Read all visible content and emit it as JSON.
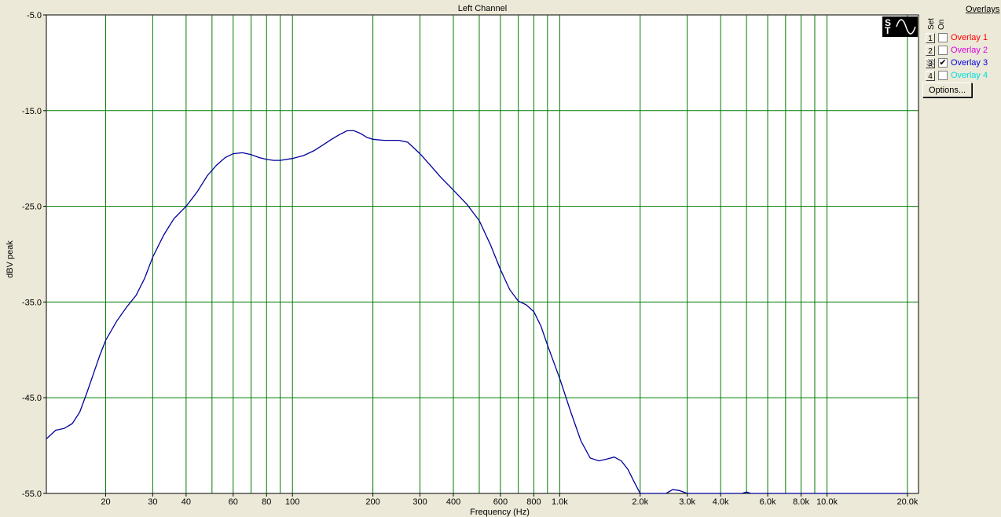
{
  "chart_data": {
    "type": "line",
    "title": "Left Channel",
    "xlabel": "Frequency (Hz)",
    "ylabel": "dBV peak",
    "x_scale": "log",
    "xlim": [
      12,
      22000
    ],
    "ylim": [
      -55,
      -5
    ],
    "y_ticks": [
      -5,
      -15,
      -25,
      -35,
      -45,
      -55
    ],
    "y_tick_labels": [
      "-5.0",
      "-15.0",
      "-25.0",
      "-35.0",
      "-45.0",
      "-55.0"
    ],
    "x_ticks": [
      20,
      30,
      40,
      60,
      80,
      100,
      200,
      300,
      400,
      600,
      800,
      1000,
      2000,
      3000,
      4000,
      6000,
      8000,
      10000,
      20000
    ],
    "x_tick_labels": [
      "20",
      "30",
      "40",
      "60",
      "80",
      "100",
      "200",
      "300",
      "400",
      "600",
      "800",
      "1.0k",
      "2.0k",
      "3.0k",
      "4.0k",
      "6.0k",
      "8.0k",
      "10.0k",
      "20.0k"
    ],
    "x_gridlines": [
      20,
      30,
      40,
      50,
      60,
      70,
      80,
      90,
      100,
      200,
      300,
      400,
      500,
      600,
      700,
      800,
      900,
      1000,
      2000,
      3000,
      4000,
      5000,
      6000,
      7000,
      8000,
      9000,
      10000,
      20000
    ],
    "grid": true,
    "background": "#ffffff",
    "grid_color": "#007a00",
    "series": [
      {
        "color": "#000099",
        "points": [
          [
            12,
            -49.3
          ],
          [
            13,
            -48.4
          ],
          [
            14,
            -48.2
          ],
          [
            15,
            -47.7
          ],
          [
            16,
            -46.5
          ],
          [
            17,
            -44.5
          ],
          [
            18,
            -42.5
          ],
          [
            19,
            -40.6
          ],
          [
            20,
            -39.0
          ],
          [
            22,
            -37.0
          ],
          [
            24,
            -35.5
          ],
          [
            26,
            -34.3
          ],
          [
            28,
            -32.5
          ],
          [
            30,
            -30.3
          ],
          [
            33,
            -28.0
          ],
          [
            36,
            -26.3
          ],
          [
            40,
            -25.0
          ],
          [
            44,
            -23.5
          ],
          [
            48,
            -21.8
          ],
          [
            52,
            -20.7
          ],
          [
            56,
            -19.9
          ],
          [
            60,
            -19.5
          ],
          [
            65,
            -19.4
          ],
          [
            70,
            -19.6
          ],
          [
            75,
            -19.9
          ],
          [
            80,
            -20.1
          ],
          [
            85,
            -20.2
          ],
          [
            90,
            -20.2
          ],
          [
            100,
            -20.0
          ],
          [
            110,
            -19.7
          ],
          [
            120,
            -19.2
          ],
          [
            130,
            -18.6
          ],
          [
            140,
            -18.0
          ],
          [
            150,
            -17.5
          ],
          [
            160,
            -17.1
          ],
          [
            170,
            -17.1
          ],
          [
            180,
            -17.4
          ],
          [
            190,
            -17.8
          ],
          [
            200,
            -18.0
          ],
          [
            220,
            -18.1
          ],
          [
            250,
            -18.1
          ],
          [
            270,
            -18.3
          ],
          [
            300,
            -19.5
          ],
          [
            330,
            -20.8
          ],
          [
            360,
            -22.0
          ],
          [
            400,
            -23.3
          ],
          [
            450,
            -24.8
          ],
          [
            500,
            -26.5
          ],
          [
            550,
            -29.0
          ],
          [
            600,
            -31.6
          ],
          [
            650,
            -33.7
          ],
          [
            700,
            -34.9
          ],
          [
            750,
            -35.3
          ],
          [
            800,
            -36.0
          ],
          [
            850,
            -37.5
          ],
          [
            900,
            -39.5
          ],
          [
            1000,
            -43.0
          ],
          [
            1100,
            -46.5
          ],
          [
            1200,
            -49.5
          ],
          [
            1300,
            -51.3
          ],
          [
            1400,
            -51.6
          ],
          [
            1500,
            -51.4
          ],
          [
            1600,
            -51.2
          ],
          [
            1700,
            -51.6
          ],
          [
            1800,
            -52.5
          ],
          [
            1900,
            -53.8
          ],
          [
            2000,
            -55.0
          ],
          [
            2500,
            -55.0
          ],
          [
            2650,
            -54.6
          ],
          [
            2800,
            -54.7
          ],
          [
            3000,
            -55.0
          ],
          [
            4800,
            -55.0
          ],
          [
            5000,
            -54.85
          ],
          [
            5200,
            -55.0
          ],
          [
            20000,
            -55.0
          ]
        ]
      }
    ]
  },
  "panel": {
    "overlays_title": "Overlays",
    "set_label": "Set",
    "on_label": "On",
    "overlays": [
      {
        "num": "1",
        "label": "Overlay 1",
        "color": "#ff0000",
        "checked": false,
        "hatched": false
      },
      {
        "num": "2",
        "label": "Overlay 2",
        "color": "#e000e0",
        "checked": false,
        "hatched": false
      },
      {
        "num": "3",
        "label": "Overlay 3",
        "color": "#0000e0",
        "checked": true,
        "hatched": true
      },
      {
        "num": "4",
        "label": "Overlay 4",
        "color": "#00e0e0",
        "checked": false,
        "hatched": false
      }
    ],
    "options_label": "Options...",
    "logo_text": "ST"
  }
}
